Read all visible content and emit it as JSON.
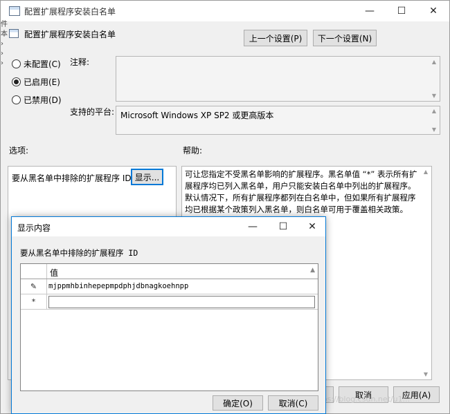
{
  "main_window": {
    "title": "配置扩展程序安装白名单",
    "header_title": "配置扩展程序安装白名单",
    "prev_button": "上一个设置(P)",
    "next_button": "下一个设置(N)",
    "radio_options": [
      {
        "label": "未配置(C)",
        "checked": false
      },
      {
        "label": "已启用(E)",
        "checked": true
      },
      {
        "label": "已禁用(D)",
        "checked": false
      }
    ],
    "comment_label": "注释:",
    "comment_value": "",
    "platform_label": "支持的平台:",
    "platform_value": "Microsoft Windows XP SP2 或更高版本",
    "options_label": "选项:",
    "help_label": "帮助:",
    "option_item_label": "要从黑名单中排除的扩展程序 ID",
    "show_button": "显示...",
    "help_text": "可让您指定不受黑名单影响的扩展程序。黑名单值 “*” 表示所有扩展程序均已列入黑名单，用户只能安装白名单中列出的扩展程序。默认情况下，所有扩展程序都列在白名单中，但如果所有扩展程序均已根据某个政策列入黑名单，则白名单可用于覆盖相关政策。",
    "cancel_button": "取消",
    "apply_button": "应用(A)"
  },
  "sub_window": {
    "title": "显示内容",
    "description": "要从黑名单中排除的扩展程序 ID",
    "column_header": "值",
    "rows": [
      {
        "marker": "✎",
        "value": "mjppmhbinhepepmpdphjdbnagkoehnpp"
      },
      {
        "marker": "*",
        "value": ""
      }
    ],
    "ok_button": "确定(O)",
    "cancel_button": "取消(C)"
  },
  "left_edge_text": [
    "件",
    "本",
    "›",
    "›",
    "›"
  ],
  "watermark": "https://blog.csdn.net/u1..."
}
